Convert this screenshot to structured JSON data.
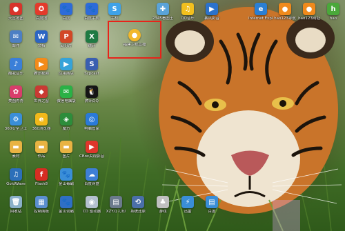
{
  "desktop": {
    "icons": [
      {
        "label": "天宫地图",
        "color": "#d8342b",
        "glyph": "●"
      },
      {
        "label": "百度地",
        "color": "#e43a2b",
        "glyph": "✪"
      },
      {
        "label": "百度",
        "color": "#2d6bd9",
        "glyph": "🐾"
      },
      {
        "label": "百度手机",
        "color": "#2d6bd9",
        "glyph": "🐾"
      },
      {
        "label": "手机",
        "color": "#3fa2e8",
        "glyph": "S"
      },
      {
        "label": "2345看图王",
        "color": "#5aa3d8",
        "glyph": "✚"
      },
      {
        "label": "QQ音乐",
        "color": "#f2c01e",
        "glyph": "♫"
      },
      {
        "label": "暴风影音",
        "color": "#2b72cc",
        "glyph": "▶"
      },
      {
        "label": "Internet Explorer",
        "color": "#2a7fd4",
        "glyph": "e"
      },
      {
        "label": "hao123导航",
        "color": "#f08a1c",
        "glyph": "●"
      },
      {
        "label": "hao123网址",
        "color": "#f08a1c",
        "glyph": "●"
      },
      {
        "label": "hao",
        "color": "#4aa83a",
        "glyph": "h"
      },
      {
        "label": "邮件",
        "color": "#4d7fc4",
        "glyph": "✉"
      },
      {
        "label": "文档",
        "color": "#2c65c3",
        "glyph": "W"
      },
      {
        "label": "幻灯片",
        "color": "#d24726",
        "glyph": "P"
      },
      {
        "label": "统计",
        "color": "#1f7a43",
        "glyph": "X"
      },
      {
        "label": "酷我音乐",
        "color": "#3b7fd8",
        "glyph": "♪"
      },
      {
        "label": "腾讯视频",
        "color": "#f38b1a",
        "glyph": "▶"
      },
      {
        "label": "应用商店",
        "color": "#36a3d9",
        "glyph": "▶"
      },
      {
        "label": "Scpcast",
        "color": "#3a5fb0",
        "glyph": "S"
      },
      {
        "label": "美图秀秀",
        "color": "#d83d6b",
        "glyph": "✿"
      },
      {
        "label": "世界之窗",
        "color": "#c93a33",
        "glyph": "◆"
      },
      {
        "label": "微信电脑版",
        "color": "#2ab146",
        "glyph": "✉"
      },
      {
        "label": "腾讯QQ",
        "color": "#151515",
        "glyph": "🐧"
      },
      {
        "label": "360安全卫士",
        "color": "#3a8ed8",
        "glyph": "⚙"
      },
      {
        "label": "360浏览器",
        "color": "#f1b81a",
        "glyph": "e"
      },
      {
        "label": "魔方",
        "color": "#2d8d3b",
        "glyph": "◈"
      },
      {
        "label": "电脑管家",
        "color": "#2a7ad8",
        "glyph": "◎"
      },
      {
        "label": "素材",
        "color": "#e9b342",
        "glyph": "▬"
      },
      {
        "label": "作品",
        "color": "#e9b342",
        "glyph": "▬"
      },
      {
        "label": "图片",
        "color": "#e9b342",
        "glyph": "▬"
      },
      {
        "label": "CBox央视影音",
        "color": "#e0362b",
        "glyph": "▶"
      },
      {
        "label": "GoldWave",
        "color": "#2c6fb9",
        "glyph": "♫"
      },
      {
        "label": "Flash8",
        "color": "#d62d22",
        "glyph": "f"
      },
      {
        "label": "金山毒霸",
        "color": "#3a8ed8",
        "glyph": "🐾"
      },
      {
        "label": "百度网盘",
        "color": "#3e7fd6",
        "glyph": "☁"
      },
      {
        "label": "回收站",
        "color": "#8ab0c8",
        "glyph": "🗑"
      },
      {
        "label": "控制面板",
        "color": "#5b8fcf",
        "glyph": "▦"
      },
      {
        "label": "金山词霸",
        "color": "#2f6fc4",
        "glyph": "🐾"
      },
      {
        "label": "CD 驱动器",
        "color": "#b4c0cf",
        "glyph": "◉"
      },
      {
        "label": "XZY.Q 打印",
        "color": "#6b7a8c",
        "glyph": "▤"
      },
      {
        "label": "系统还原",
        "color": "#4a6fa8",
        "glyph": "⟲"
      },
      {
        "label": "游戏",
        "color": "#c0c0c0",
        "glyph": "♣"
      },
      {
        "label": "迅雷",
        "color": "#3a8ed8",
        "glyph": "⚡"
      },
      {
        "label": "百度",
        "color": "#3a8ed8",
        "glyph": "▤"
      }
    ],
    "selected_icon": {
      "label": "福建卫视直播",
      "color": "#f2b82c",
      "glyph": "●"
    }
  }
}
